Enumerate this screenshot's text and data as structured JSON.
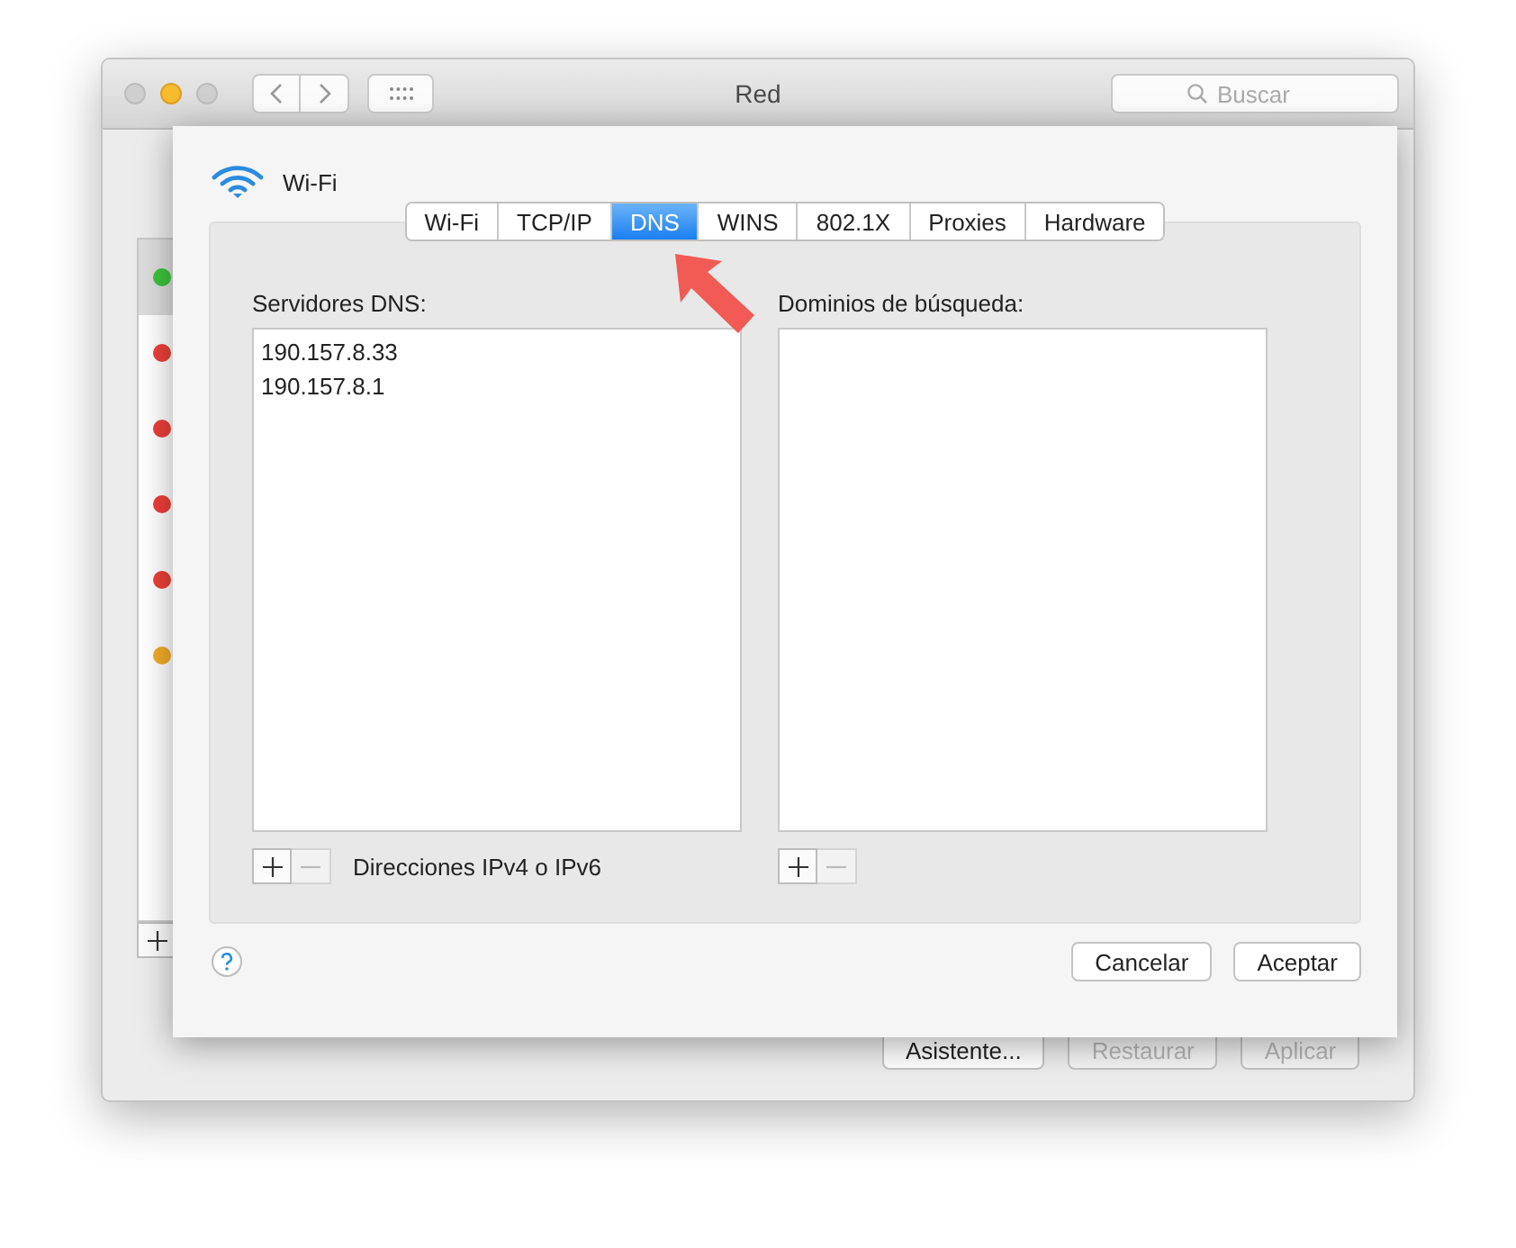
{
  "window": {
    "title": "Red",
    "search": {
      "placeholder": "Buscar"
    }
  },
  "services": [
    {
      "color": "#3cc43c",
      "selected": true
    },
    {
      "color": "#ec3f3a",
      "selected": false
    },
    {
      "color": "#ec3f3a",
      "selected": false
    },
    {
      "color": "#ec3f3a",
      "selected": false
    },
    {
      "color": "#ec3f3a",
      "selected": false
    },
    {
      "color": "#f0ad28",
      "selected": false
    }
  ],
  "window_buttons": [
    {
      "label": "Asistente...",
      "disabled": false
    },
    {
      "label": "Restaurar",
      "disabled": true
    },
    {
      "label": "Aplicar",
      "disabled": true
    }
  ],
  "sheet": {
    "interface": "Wi-Fi",
    "tabs": [
      {
        "label": "Wi-Fi",
        "selected": false
      },
      {
        "label": "TCP/IP",
        "selected": false
      },
      {
        "label": "DNS",
        "selected": true
      },
      {
        "label": "WINS",
        "selected": false
      },
      {
        "label": "802.1X",
        "selected": false
      },
      {
        "label": "Proxies",
        "selected": false
      },
      {
        "label": "Hardware",
        "selected": false
      }
    ],
    "dns_servers": {
      "label": "Servidores DNS:",
      "items": [
        "190.157.8.33",
        "190.157.8.1"
      ],
      "hint": "Direcciones IPv4 o IPv6"
    },
    "search_domains": {
      "label": "Dominios de búsqueda:"
    },
    "buttons": [
      "Cancelar",
      "Aceptar"
    ]
  }
}
